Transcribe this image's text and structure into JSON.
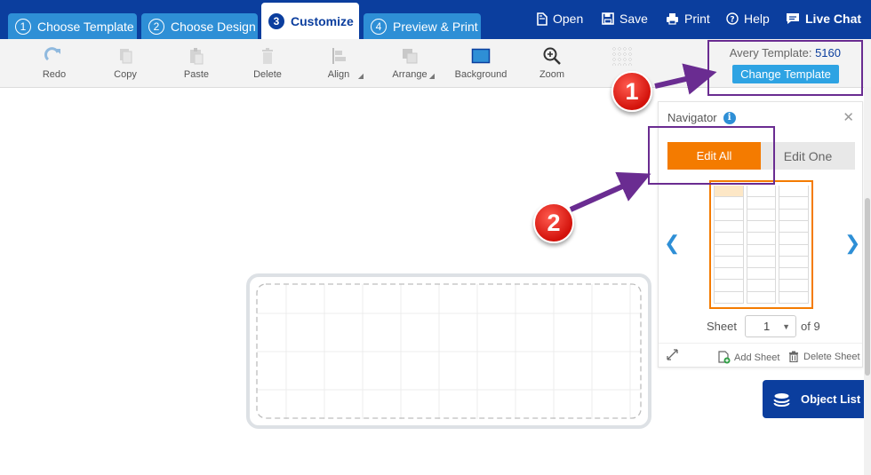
{
  "tabs": [
    {
      "num": "1",
      "label": "Choose Template"
    },
    {
      "num": "2",
      "label": "Choose Design"
    },
    {
      "num": "3",
      "label": "Customize"
    },
    {
      "num": "4",
      "label": "Preview & Print"
    }
  ],
  "top_actions": {
    "open": "Open",
    "save": "Save",
    "print": "Print",
    "help": "Help",
    "chat": "Live Chat"
  },
  "toolbar": {
    "redo": "Redo",
    "copy": "Copy",
    "paste": "Paste",
    "delete": "Delete",
    "align": "Align",
    "arrange": "Arrange",
    "background": "Background",
    "zoom": "Zoom"
  },
  "template": {
    "label": "Avery Template:",
    "number": "5160",
    "change_button": "Change Template"
  },
  "navigator": {
    "title": "Navigator",
    "edit_all": "Edit All",
    "edit_one": "Edit One",
    "sheet_label": "Sheet",
    "sheet_value": "1",
    "sheet_of": "of 9",
    "add_sheet": "Add Sheet",
    "delete_sheet": "Delete Sheet"
  },
  "object_list": "Object List",
  "callouts": [
    "1",
    "2"
  ],
  "colors": {
    "brand_blue": "#0b3e9e",
    "tab_blue": "#2e8fd6",
    "orange": "#f47b00",
    "callout_purple": "#6a2c91",
    "callout_red": "#d3120b"
  }
}
